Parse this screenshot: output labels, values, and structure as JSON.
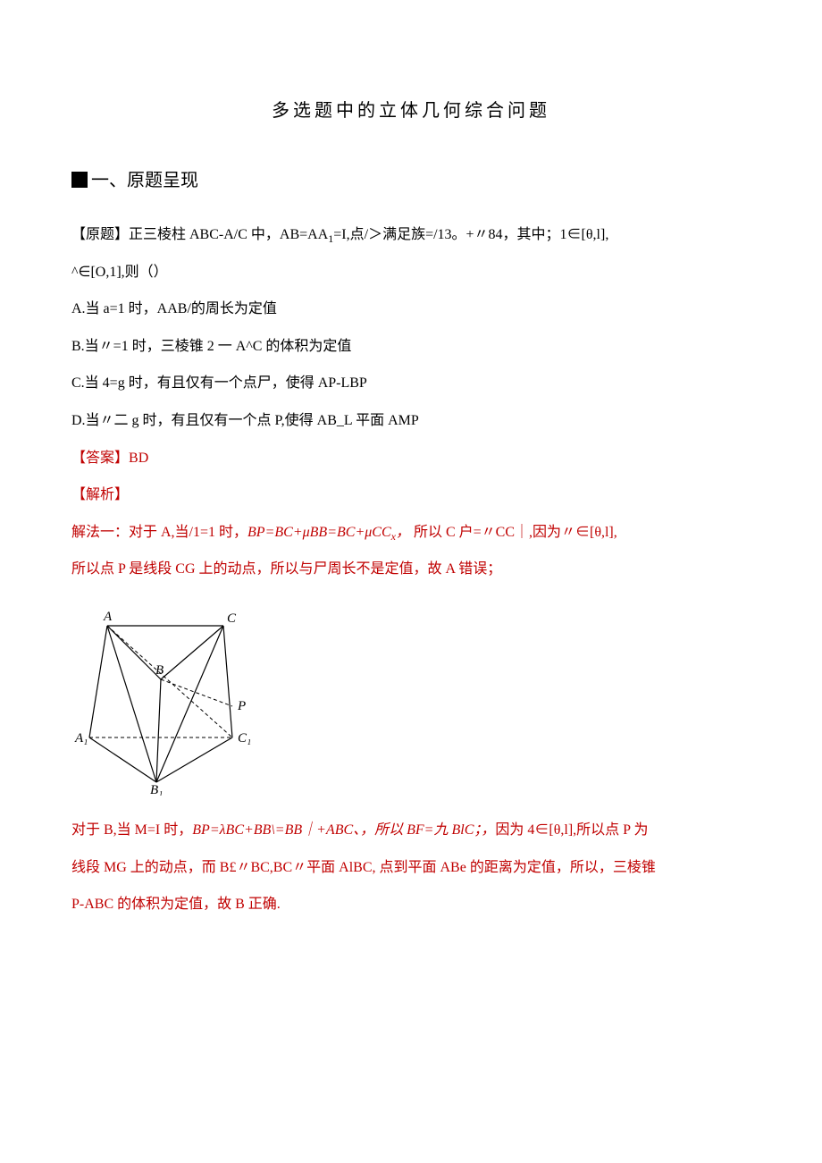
{
  "title": "多选题中的立体几何综合问题",
  "section1": {
    "square": "■",
    "label": "一、原题呈现"
  },
  "problem": {
    "line1_a": "【原题】正三棱柱 ABC-A/C 中，AB=AA",
    "line1_sub": "1",
    "line1_b": "=I,点/＞满足族=/13。+〃84，其中；1∈[θ,l],",
    "line2": "^∈[O,1],则（）",
    "optA": "A.当 a=1 时，AAB/的周长为定值",
    "optB": "B.当〃=1 时，三棱锥 2 一 A^C 的体积为定值",
    "optC": "C.当 4=g 时，有且仅有一个点尸，使得 AP-LBP",
    "optD": "D.当〃二 g 时，有且仅有一个点 P,使得 AB_L 平面 AMP"
  },
  "answer": {
    "label": "【答案】",
    "value": "BD"
  },
  "analysis_label": "【解析】",
  "sol1": {
    "l1_a": "解法一：对于 A,当/1=1 时，",
    "l1_b": "BP=BC+μBB=BC+μCC",
    "l1_bsub": "x",
    "l1_c": "，",
    "l1_d": " 所以 C 户=〃CC｜,因为〃∈[θ,l],",
    "l2": "所以点 P 是线段 CG 上的动点，所以与尸周长不是定值，故 A 错误；"
  },
  "diagram": {
    "A": "A",
    "C": "C",
    "B": "B",
    "P": "P",
    "A1": "A₁",
    "C1": "C₁",
    "B1": "B₁"
  },
  "sol2": {
    "l1_a": "对于 B,当 M=I 时，",
    "l1_b": "BP=λBC+BB\\=BB｜+ABC、，所以 BF=九 BlC；，",
    "l1_c": "因为 4∈[θ,l],所以点 P 为",
    "l2_a": "线段 MG 上的动点，而 B£〃BC,BC〃平面 AlBC, 点到平面 ABe 的距离为定值，所以，三棱锥",
    "l3": "P-ABC 的体积为定值，故 B 正确."
  }
}
